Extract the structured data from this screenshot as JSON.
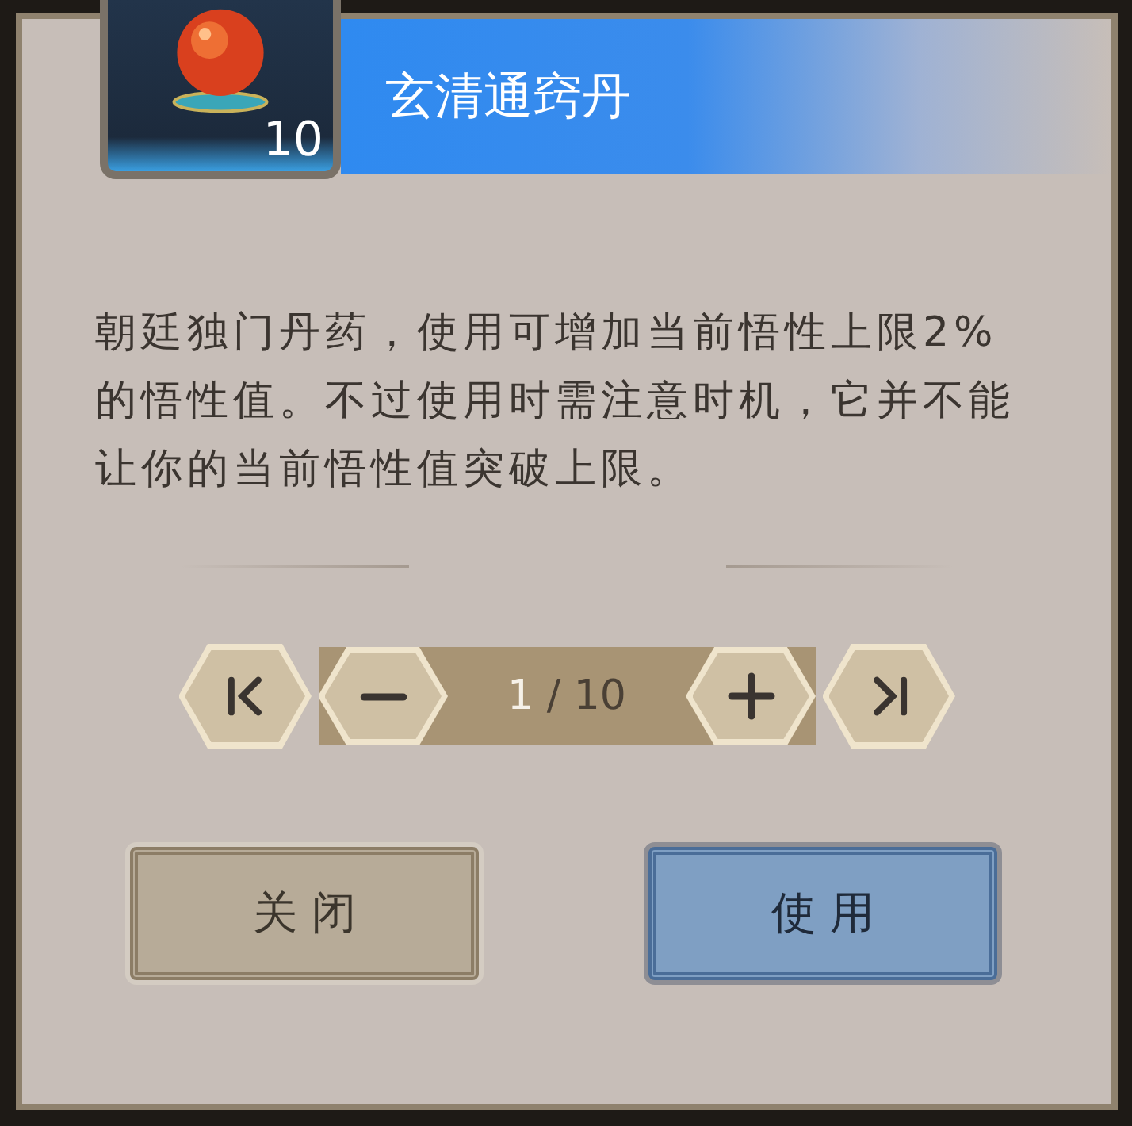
{
  "item": {
    "count": "10",
    "name": "玄清通窍丹"
  },
  "description": "朝廷独门丹药，使用可增加当前悟性上限2%的悟性值。不过使用时需注意时机，它并不能让你的当前悟性值突破上限。",
  "quantity": {
    "current": "1",
    "rest": "/ 10"
  },
  "buttons": [
    {
      "label": "关 闭",
      "kind": "secondary"
    },
    {
      "label": "使 用",
      "kind": "primary"
    }
  ]
}
